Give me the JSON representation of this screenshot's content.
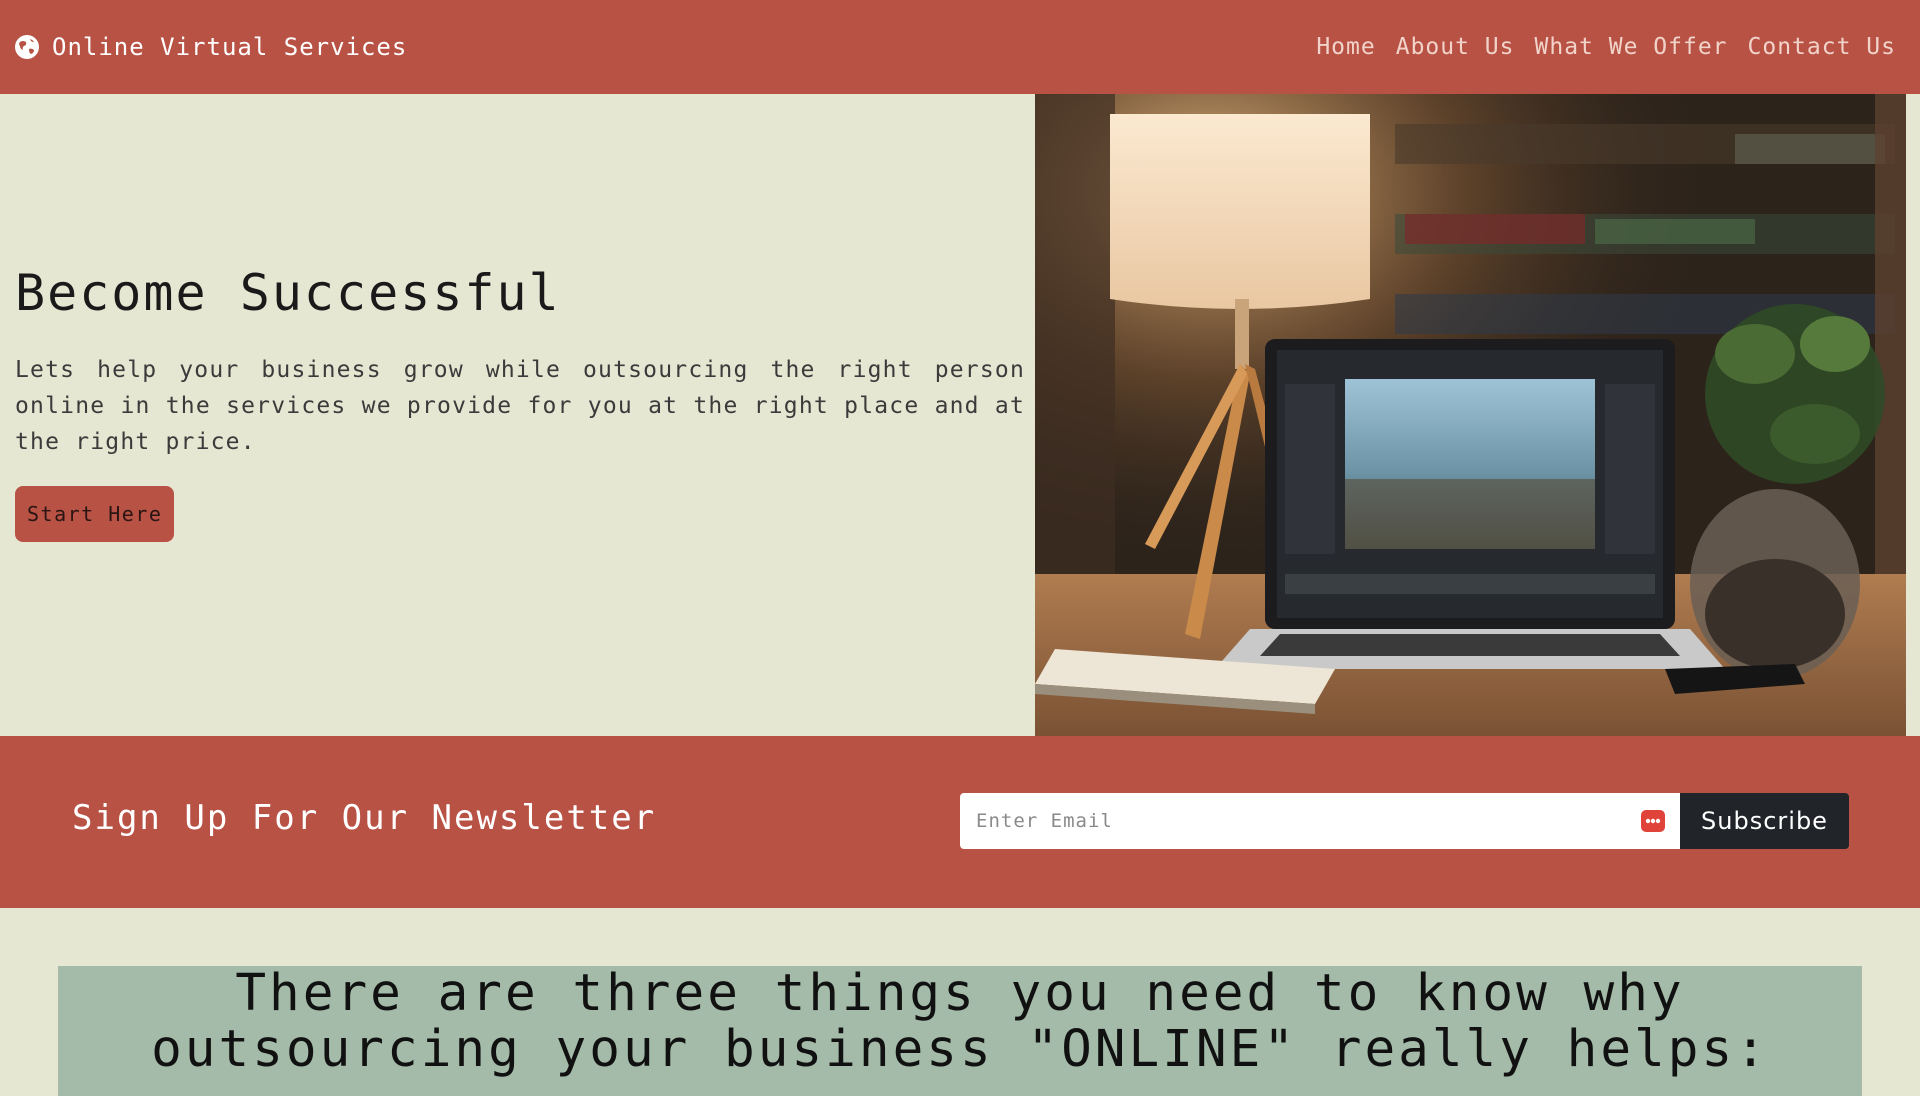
{
  "header": {
    "brand_icon": "globe-icon",
    "brand_name": "Online Virtual Services",
    "nav": [
      {
        "label": "Home"
      },
      {
        "label": "About Us"
      },
      {
        "label": "What We Offer"
      },
      {
        "label": "Contact Us"
      }
    ]
  },
  "hero": {
    "title": "Become Successful",
    "description": "Lets help your business grow while outsourcing the right person online in the services we provide for you at the right place and at the right price.",
    "button_label": "Start Here",
    "image_icon": "laptop-desk-photo"
  },
  "newsletter": {
    "title": "Sign Up For Our Newsletter",
    "email_placeholder": "Enter Email",
    "email_icon": "password-dots-icon",
    "subscribe_label": "Subscribe"
  },
  "section": {
    "heading": "There are three things you need to know why outsourcing your business \"ONLINE\" really helps:"
  },
  "colors": {
    "accent": "#b85245",
    "background": "#e6e7d2",
    "panel": "#a3bba8",
    "dark_button": "#212529"
  }
}
